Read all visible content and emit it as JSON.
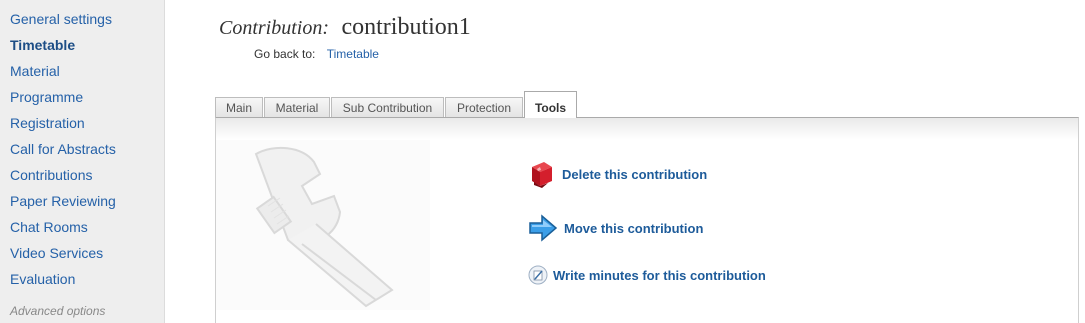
{
  "sidebar": {
    "items": [
      {
        "label": "General settings"
      },
      {
        "label": "Timetable",
        "active": true
      },
      {
        "label": "Material"
      },
      {
        "label": "Programme"
      },
      {
        "label": "Registration"
      },
      {
        "label": "Call for Abstracts"
      },
      {
        "label": "Contributions"
      },
      {
        "label": "Paper Reviewing"
      },
      {
        "label": "Chat Rooms"
      },
      {
        "label": "Video Services"
      },
      {
        "label": "Evaluation"
      }
    ],
    "advanced_label": "Advanced options"
  },
  "header": {
    "title_label": "Contribution:",
    "title_value": "contribution1",
    "goback_label": "Go back to:",
    "goback_link": "Timetable"
  },
  "tabs": [
    {
      "label": "Main"
    },
    {
      "label": "Material"
    },
    {
      "label": "Sub Contribution"
    },
    {
      "label": "Protection"
    },
    {
      "label": "Tools",
      "active": true
    }
  ],
  "actions": [
    {
      "label": "Delete this contribution",
      "icon": "delete-icon"
    },
    {
      "label": "Move this contribution",
      "icon": "move-arrow-icon"
    },
    {
      "label": "Write minutes for this contribution",
      "icon": "write-minutes-icon"
    }
  ],
  "colors": {
    "link": "#2561a8",
    "sidebar_bg": "#eeeeee",
    "delete_icon": "#c8102e",
    "move_icon": "#2f95e0"
  }
}
